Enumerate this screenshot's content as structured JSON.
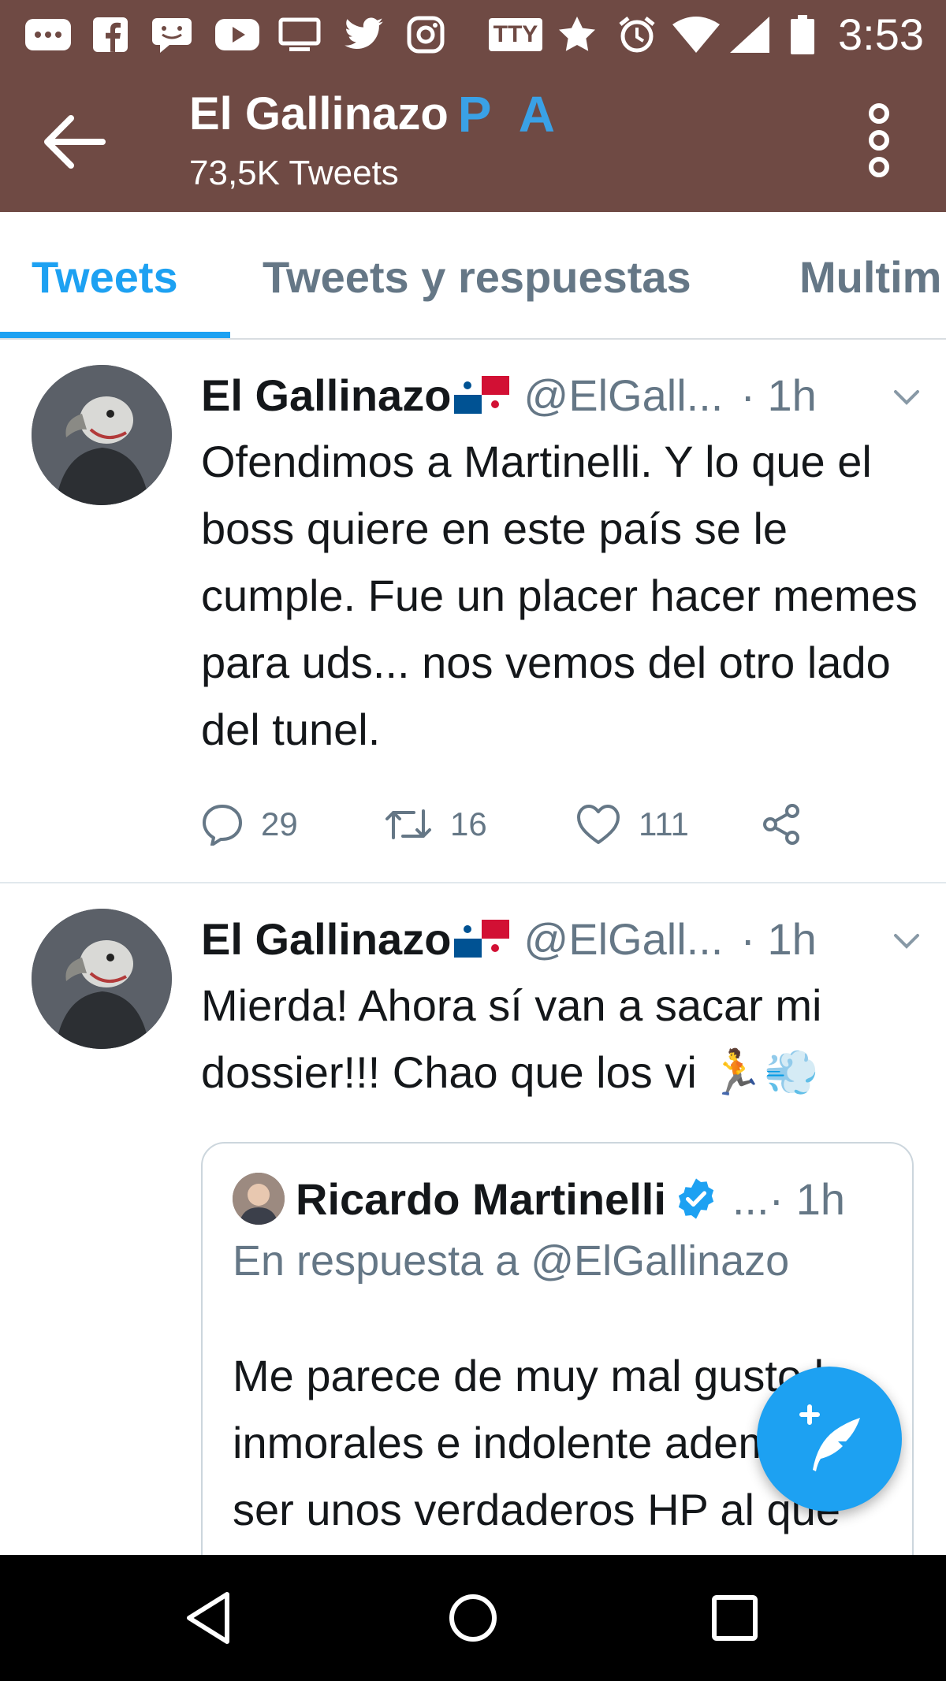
{
  "status_bar": {
    "time": "3:53",
    "tty_label": "TTY",
    "icons": [
      "messages-icon",
      "facebook-icon",
      "chat-icon",
      "youtube-icon",
      "screen-icon",
      "twitter-icon",
      "instagram-icon",
      "tty-icon",
      "star-icon",
      "alarm-icon",
      "wifi-icon",
      "signal-icon",
      "battery-icon"
    ]
  },
  "app_bar": {
    "title": "El Gallinazo",
    "title_flag": "P A",
    "subtitle": "73,5K Tweets"
  },
  "tabs": [
    {
      "label": "Tweets",
      "active": true
    },
    {
      "label": "Tweets y respuestas",
      "active": false
    },
    {
      "label": "Multim",
      "active": false
    }
  ],
  "tweets": [
    {
      "author": "El Gallinazo",
      "handle": "@ElGall...",
      "time": "· 1h",
      "text": "Ofendimos a Martinelli. Y lo que el boss quiere en este país se le cumple. Fue un placer hacer memes para uds...  nos vemos del otro lado del tunel.",
      "replies": "29",
      "retweets": "16",
      "likes": "111"
    },
    {
      "author": "El Gallinazo",
      "handle": "@ElGall...",
      "time": "· 1h",
      "text": "Mierda! Ahora sí van a sacar mi dossier!!! Chao que los vi 🏃💨",
      "quoted": {
        "author": "Ricardo Martinelli",
        "time": "...· 1h",
        "reply_to": "En respuesta a @ElGallinazo",
        "text": "Me parece de muy mal gusto lo inmorales e indolente además de ser unos verdaderos HP al que"
      }
    }
  ],
  "colors": {
    "header_bg": "#6f4a44",
    "accent": "#1da1f2",
    "muted": "#657786"
  }
}
